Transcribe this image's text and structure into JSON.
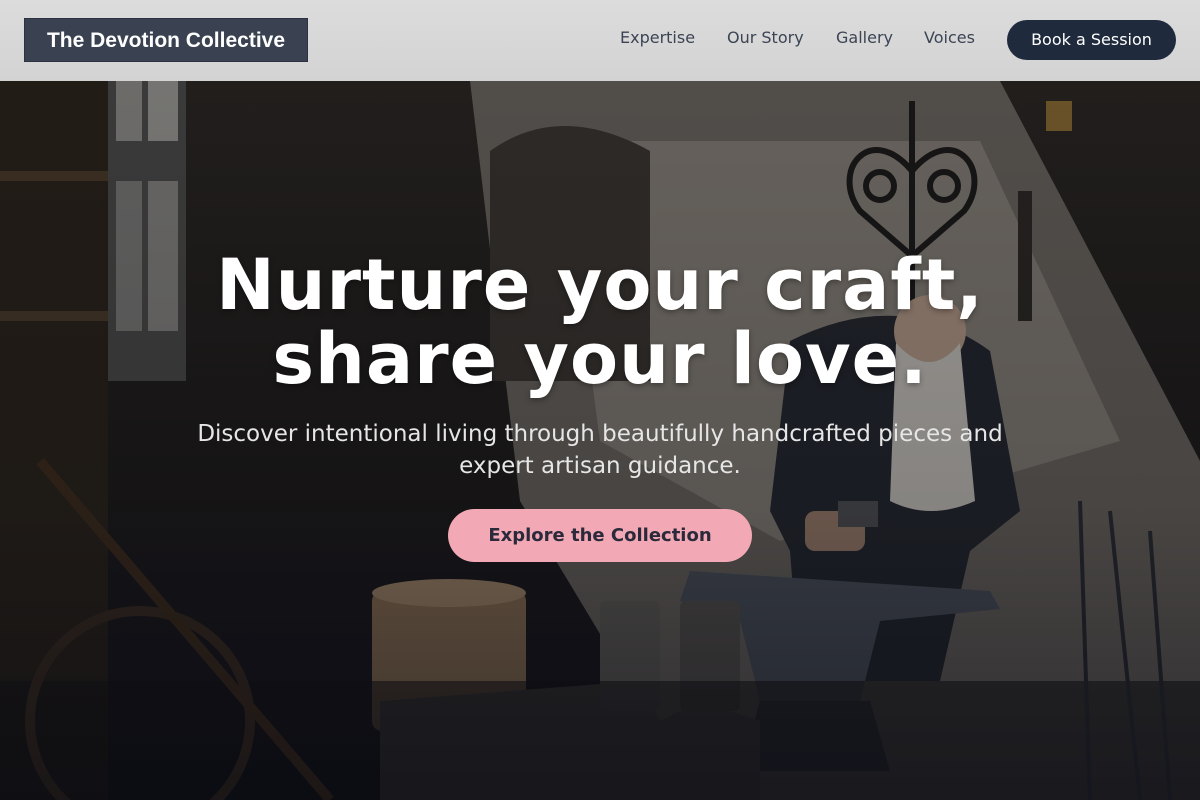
{
  "header": {
    "logo": "The Devotion Collective",
    "nav": [
      "Expertise",
      "Our Story",
      "Gallery",
      "Voices"
    ],
    "cta": "Book a Session"
  },
  "hero": {
    "headline_line1": "Nurture your craft,",
    "headline_line2": "share your love.",
    "subtitle": "Discover intentional living through beautifully handcrafted pieces and expert artisan guidance.",
    "cta": "Explore the Collection",
    "background_image": "blacksmith-workshop-photo"
  },
  "colors": {
    "header_bg": "#d6d6d6",
    "logo_bg": "#3a4252",
    "nav_text": "#3b4454",
    "cta_dark": "#1f2a3d",
    "cta_pink": "#f2a9b5"
  }
}
